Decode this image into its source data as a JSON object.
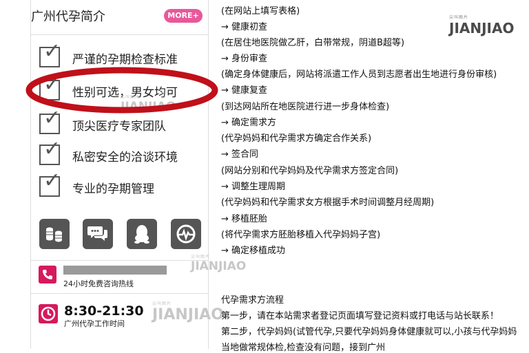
{
  "sidebar": {
    "title": "广州代孕简介",
    "more_button": "MORE+",
    "features": [
      {
        "label": "严谨的孕期检查标准"
      },
      {
        "label": "性别可选，男女均可"
      },
      {
        "label": "顶尖医疗专家团队"
      },
      {
        "label": "私密安全的洽谈环境"
      },
      {
        "label": "专业的孕期管理"
      }
    ],
    "icons": [
      "coins-icon",
      "chat-bubbles-icon",
      "qq-penguin-icon",
      "heartbeat-icon"
    ],
    "hotline": {
      "label": "24小时免费咨询热线"
    },
    "hours": {
      "value": "8:30-21:30",
      "label": "广州代孕工作时间"
    }
  },
  "watermark": {
    "brand": "JIANJIAO",
    "small_text": "尖叫图片"
  },
  "content": {
    "steps": [
      "(在网站上填写表格)",
      "→ 健康初查",
      "(在居住地医院做乙肝，白带常规，阴道B超等)",
      "→ 身份审查",
      "(确定身体健康后，网站将派遣工作人员到志愿者出生地进行身份审核)",
      "→ 健康复查",
      "(到达网站所在地医院进行进一步身体检查)",
      "→ 确定需求方",
      "(代孕妈妈和代孕需求方确定合作关系)",
      "→ 签合同",
      "(网站分别和代孕妈妈及代孕需求方签定合同)",
      "→ 调整生理周期",
      "(代孕妈妈和代孕需求女方根据手术时间调整月经周期)",
      "→ 移植胚胎",
      "(将代孕需求方胚胎移植入代孕妈妈子宫)",
      "→ 确定移植成功"
    ],
    "section_title": "代孕需求方流程",
    "paragraphs": [
      "第一步，请在本站需求者登记页面填写登记资料或打电话与站长联系！",
      "第二步，代孕妈妈(试管代孕,只要代孕妈妈身体健康就可以,小孩与代孕妈妈",
      "当地做常规体检,检查没有问题，接到广州"
    ]
  },
  "colors": {
    "accent": "#d6195c",
    "more": "#e8589a",
    "highlight": "#c0101a",
    "icon": "#555555"
  }
}
